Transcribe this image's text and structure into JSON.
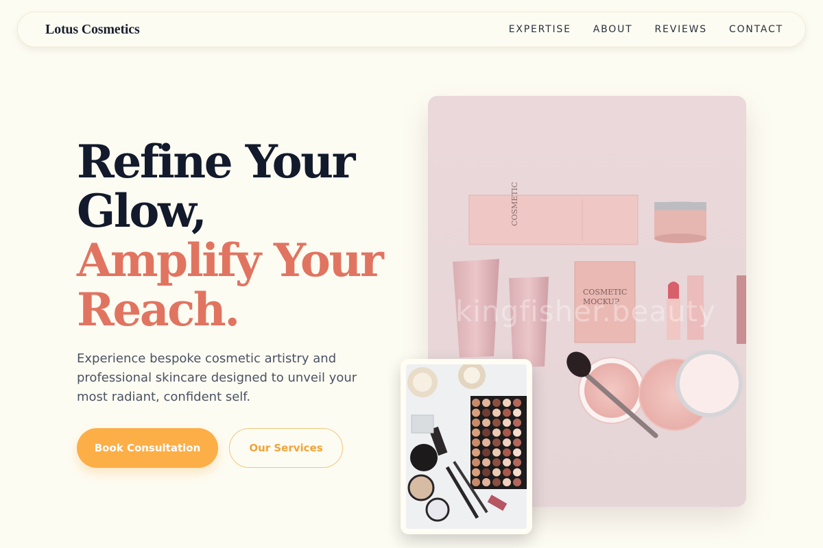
{
  "header": {
    "brand": "Lotus Cosmetics",
    "nav": [
      "EXPERTISE",
      "ABOUT",
      "REVIEWS",
      "CONTACT"
    ]
  },
  "hero": {
    "headline_line1": "Refine Your",
    "headline_line2": "Glow,",
    "headline_line3": "Amplify Your",
    "headline_line4": "Reach.",
    "lead": "Experience bespoke cosmetic artistry and professional skincare designed to unveil your most radiant, confident self.",
    "primary_cta": "Book Consultation",
    "secondary_cta": "Our Services",
    "image_watermark": "kingfisher.beauty"
  },
  "colors": {
    "background": "#fdfcf3",
    "headline_dark": "#121a2b",
    "headline_accent": "#e17460",
    "primary_button": "#fcae47",
    "image_pink": "#ecdadc"
  }
}
